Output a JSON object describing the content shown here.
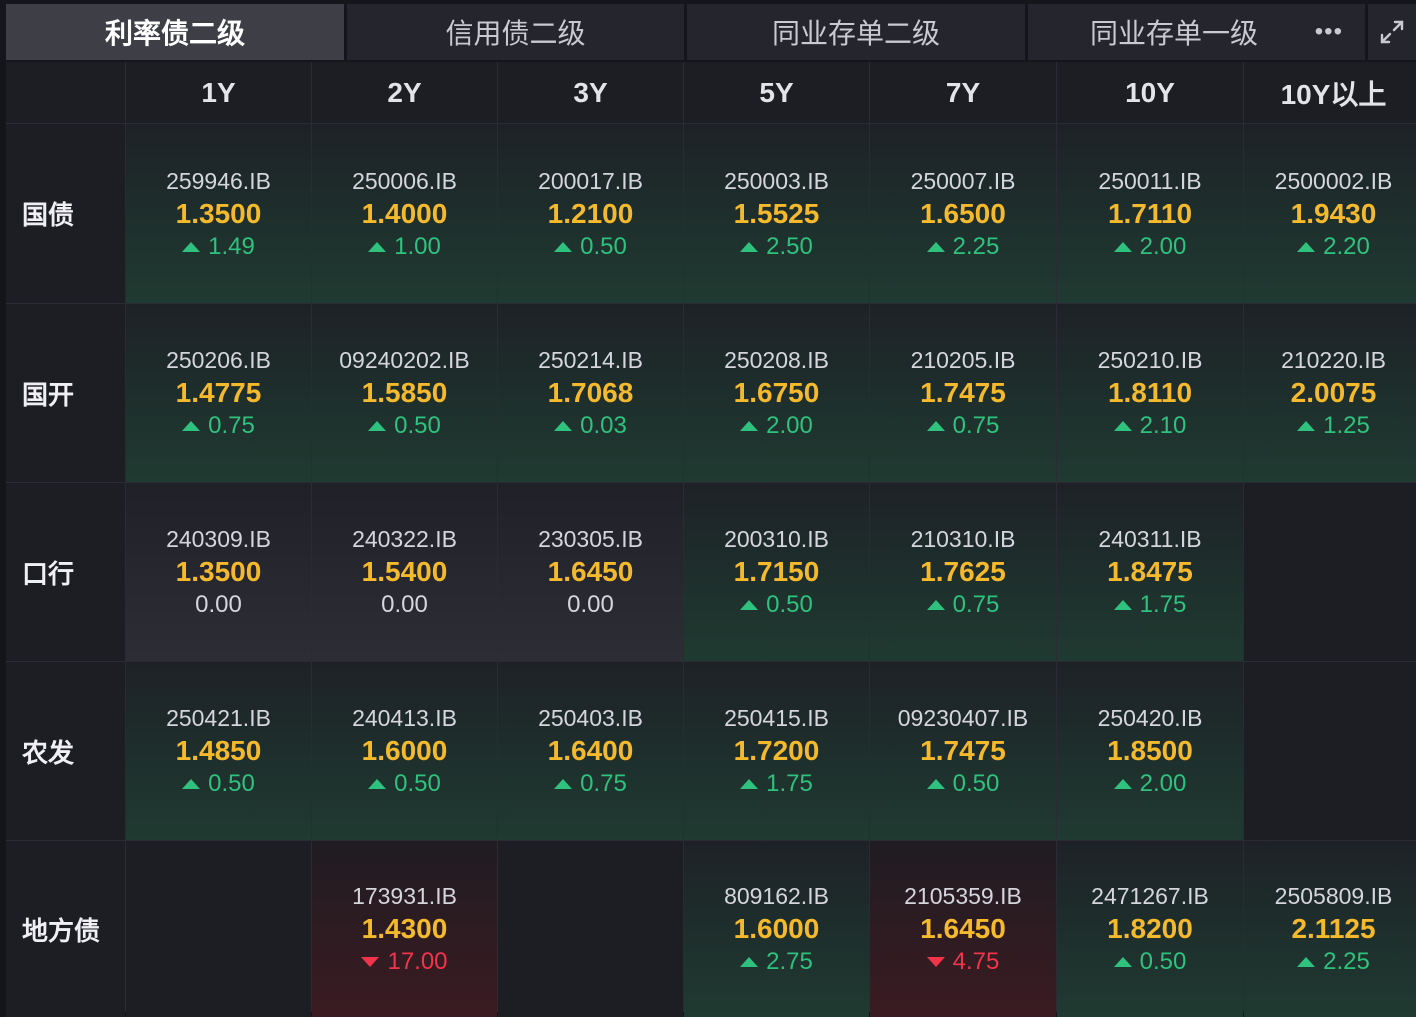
{
  "tabs": [
    {
      "label": "利率债二级",
      "active": true
    },
    {
      "label": "信用债二级",
      "active": false
    },
    {
      "label": "同业存单二级",
      "active": false
    },
    {
      "label": "同业存单一级",
      "active": false
    }
  ],
  "more_icon": "•••",
  "colors": {
    "up": "#2ec27e",
    "down": "#f2344b",
    "rate": "#f5b92c"
  },
  "columns": [
    "1Y",
    "2Y",
    "3Y",
    "5Y",
    "7Y",
    "10Y",
    "10Y以上"
  ],
  "rows": [
    {
      "label": "国债",
      "cells": [
        {
          "code": "259946.IB",
          "rate": "1.3500",
          "change": "1.49",
          "dir": "up"
        },
        {
          "code": "250006.IB",
          "rate": "1.4000",
          "change": "1.00",
          "dir": "up"
        },
        {
          "code": "200017.IB",
          "rate": "1.2100",
          "change": "0.50",
          "dir": "up"
        },
        {
          "code": "250003.IB",
          "rate": "1.5525",
          "change": "2.50",
          "dir": "up"
        },
        {
          "code": "250007.IB",
          "rate": "1.6500",
          "change": "2.25",
          "dir": "up"
        },
        {
          "code": "250011.IB",
          "rate": "1.7110",
          "change": "2.00",
          "dir": "up"
        },
        {
          "code": "2500002.IB",
          "rate": "1.9430",
          "change": "2.20",
          "dir": "up"
        }
      ]
    },
    {
      "label": "国开",
      "cells": [
        {
          "code": "250206.IB",
          "rate": "1.4775",
          "change": "0.75",
          "dir": "up"
        },
        {
          "code": "09240202.IB",
          "rate": "1.5850",
          "change": "0.50",
          "dir": "up"
        },
        {
          "code": "250214.IB",
          "rate": "1.7068",
          "change": "0.03",
          "dir": "up"
        },
        {
          "code": "250208.IB",
          "rate": "1.6750",
          "change": "2.00",
          "dir": "up"
        },
        {
          "code": "210205.IB",
          "rate": "1.7475",
          "change": "0.75",
          "dir": "up"
        },
        {
          "code": "250210.IB",
          "rate": "1.8110",
          "change": "2.10",
          "dir": "up"
        },
        {
          "code": "210220.IB",
          "rate": "2.0075",
          "change": "1.25",
          "dir": "up"
        }
      ]
    },
    {
      "label": "口行",
      "cells": [
        {
          "code": "240309.IB",
          "rate": "1.3500",
          "change": "0.00",
          "dir": "flat"
        },
        {
          "code": "240322.IB",
          "rate": "1.5400",
          "change": "0.00",
          "dir": "flat"
        },
        {
          "code": "230305.IB",
          "rate": "1.6450",
          "change": "0.00",
          "dir": "flat"
        },
        {
          "code": "200310.IB",
          "rate": "1.7150",
          "change": "0.50",
          "dir": "up"
        },
        {
          "code": "210310.IB",
          "rate": "1.7625",
          "change": "0.75",
          "dir": "up"
        },
        {
          "code": "240311.IB",
          "rate": "1.8475",
          "change": "1.75",
          "dir": "up"
        },
        null
      ]
    },
    {
      "label": "农发",
      "cells": [
        {
          "code": "250421.IB",
          "rate": "1.4850",
          "change": "0.50",
          "dir": "up"
        },
        {
          "code": "240413.IB",
          "rate": "1.6000",
          "change": "0.50",
          "dir": "up"
        },
        {
          "code": "250403.IB",
          "rate": "1.6400",
          "change": "0.75",
          "dir": "up"
        },
        {
          "code": "250415.IB",
          "rate": "1.7200",
          "change": "1.75",
          "dir": "up"
        },
        {
          "code": "09230407.IB",
          "rate": "1.7475",
          "change": "0.50",
          "dir": "up"
        },
        {
          "code": "250420.IB",
          "rate": "1.8500",
          "change": "2.00",
          "dir": "up"
        },
        null
      ]
    },
    {
      "label": "地方债",
      "cells": [
        null,
        {
          "code": "173931.IB",
          "rate": "1.4300",
          "change": "17.00",
          "dir": "down"
        },
        null,
        {
          "code": "809162.IB",
          "rate": "1.6000",
          "change": "2.75",
          "dir": "up"
        },
        {
          "code": "2105359.IB",
          "rate": "1.6450",
          "change": "4.75",
          "dir": "down"
        },
        {
          "code": "2471267.IB",
          "rate": "1.8200",
          "change": "0.50",
          "dir": "up"
        },
        {
          "code": "2505809.IB",
          "rate": "2.1125",
          "change": "2.25",
          "dir": "up"
        }
      ]
    }
  ]
}
